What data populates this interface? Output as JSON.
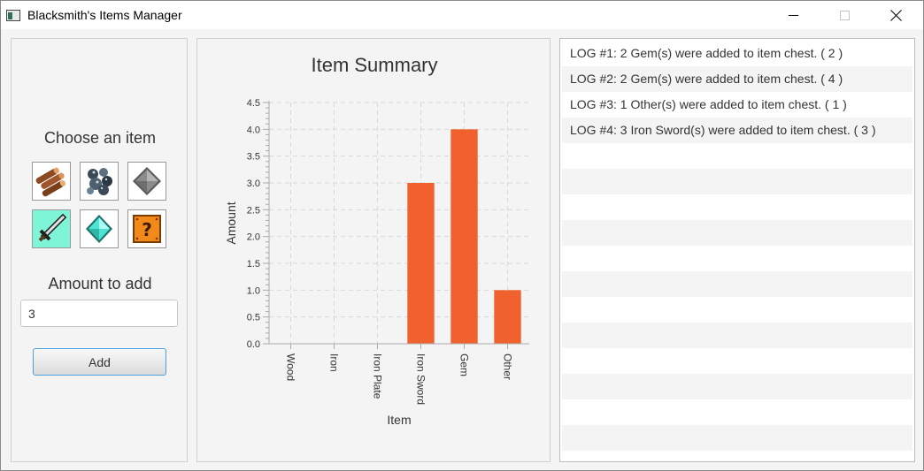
{
  "window": {
    "title": "Blacksmith's Items Manager"
  },
  "left_panel": {
    "choose_label": "Choose an item",
    "items": [
      {
        "name": "Wood",
        "icon": "wood-icon",
        "selected": false
      },
      {
        "name": "Iron",
        "icon": "iron-ore-icon",
        "selected": false
      },
      {
        "name": "Iron Plate",
        "icon": "iron-plate-icon",
        "selected": false
      },
      {
        "name": "Iron Sword",
        "icon": "iron-sword-icon",
        "selected": true
      },
      {
        "name": "Gem",
        "icon": "gem-icon",
        "selected": false
      },
      {
        "name": "Other",
        "icon": "question-block-icon",
        "selected": false
      }
    ],
    "amount_label": "Amount to add",
    "amount_value": "3",
    "add_button_label": "Add"
  },
  "chart_data": {
    "type": "bar",
    "title": "Item Summary",
    "xlabel": "Item",
    "ylabel": "Amount",
    "categories": [
      "Wood",
      "Iron",
      "Iron Plate",
      "Iron Sword",
      "Gem",
      "Other"
    ],
    "values": [
      0,
      0,
      0,
      3,
      4,
      1
    ],
    "ylim": [
      0,
      4.5
    ],
    "yticks": [
      "0.0",
      "0.5",
      "1.0",
      "1.5",
      "2.0",
      "2.5",
      "3.0",
      "3.5",
      "4.0",
      "4.5"
    ],
    "grid": true,
    "bar_color": "#f0612e"
  },
  "log": {
    "entries": [
      "LOG #1: 2 Gem(s) were added to item chest. ( 2 )",
      "LOG #2: 2 Gem(s) were added to item chest. ( 4 )",
      "LOG #3: 1 Other(s) were added to item chest. ( 1 )",
      "LOG #4: 3 Iron Sword(s) were added to item chest. ( 3 )"
    ],
    "visible_rows": 16
  },
  "colors": {
    "selected_item": "#7ff5d7",
    "button_focus_border": "#4b9ee0"
  }
}
